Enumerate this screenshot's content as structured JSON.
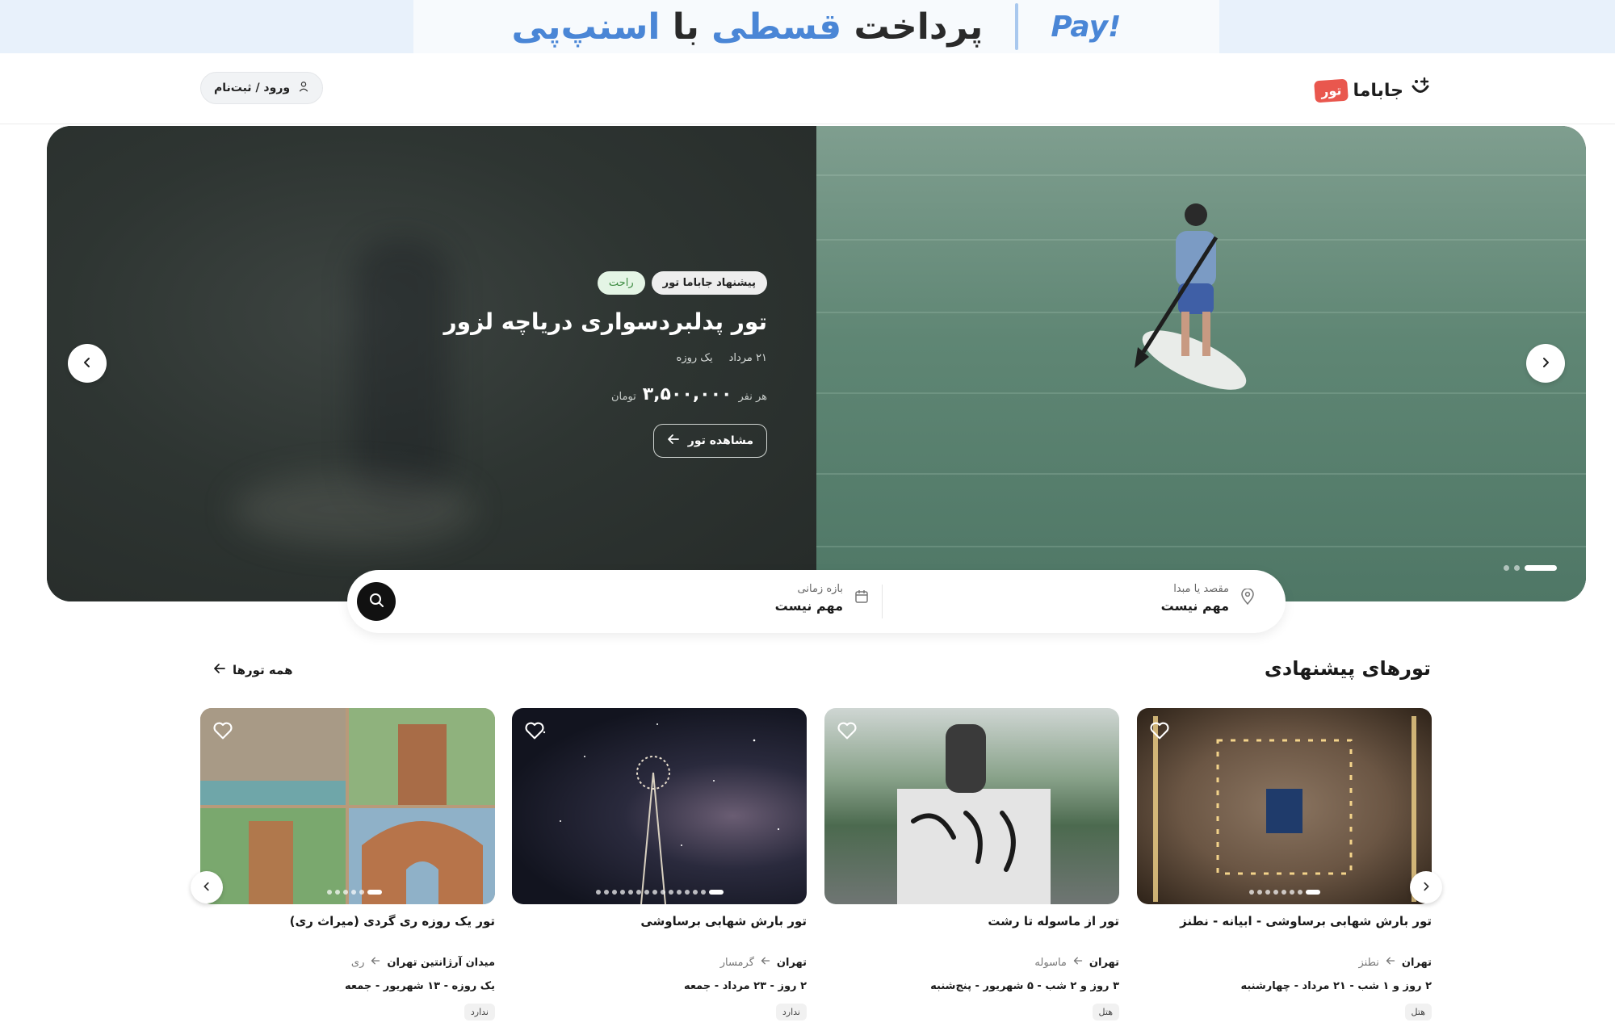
{
  "promo": {
    "pay_logo": "Pay!",
    "text_1": "پرداخت",
    "text_2": "قسطی",
    "text_3": "با",
    "text_4": "اسنپ‌پی"
  },
  "header": {
    "logo_text": "جاباما",
    "logo_badge": "تور",
    "login_label": "ورود / ثبت‌نام"
  },
  "hero": {
    "tag_suggested": "پیشنهاد جاباما تور",
    "tag_level": "راحت",
    "title": "تور پدلبردسواری دریاچه لزور",
    "date": "۲۱ مرداد",
    "duration": "یک روزه",
    "price_prefix": "هر نفر",
    "price": "۳,۵۰۰,۰۰۰",
    "currency": "تومان",
    "cta": "مشاهده تور",
    "slides_total": 3,
    "active_slide": 1
  },
  "search": {
    "destination_label": "مقصد یا مبدا",
    "destination_value": "مهم نیست",
    "date_label": "بازه زمانی",
    "date_value": "مهم نیست"
  },
  "section": {
    "title": "تورهای پیشنهادی",
    "all_link": "همه تورها"
  },
  "cards": [
    {
      "title": "تور بارش شهابی برساوشی - ابیانه - نطنز",
      "from": "تهران",
      "to": "نطنز",
      "when": "۲ روز و ۱ شب - ۲۱ مرداد - چهارشنبه",
      "badge": "هتل"
    },
    {
      "title": "تور از ماسوله تا رشت",
      "from": "تهران",
      "to": "ماسوله",
      "when": "۳ روز و ۲ شب - ۵ شهریور - پنج‌شنبه",
      "badge": "هتل"
    },
    {
      "title": "تور بارش شهابی برساوشی",
      "from": "تهران",
      "to": "گرمسار",
      "when": "۲ روز - ۲۳ مرداد - جمعه",
      "badge": "ندارد"
    },
    {
      "title": "تور یک روزه ری گردی (میراث ری)",
      "from": "میدان آرژانتین تهران",
      "to": "ری",
      "when": "یک روزه - ۱۳ شهریور - جمعه",
      "badge": "ندارد"
    }
  ],
  "colors": {
    "promo_bg": "#e8f1fb",
    "snapp_blue": "#4a86d6",
    "logo_badge": "#e9574e",
    "tag_green": "#3b8a3f",
    "search_button": "#111111"
  }
}
